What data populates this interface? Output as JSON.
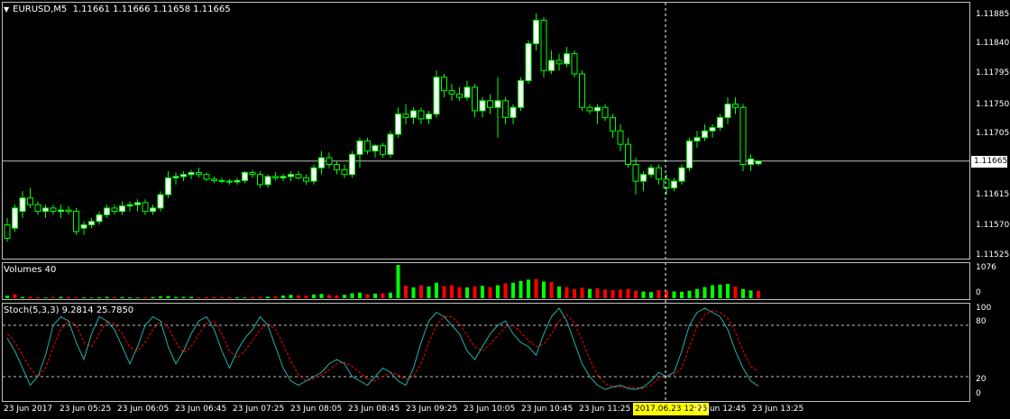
{
  "main": {
    "symbol": "EURUSD,M5",
    "ohlc": "1.11661 1.11666 1.11658 1.11665",
    "price_scale": [
      "1.11885",
      "1.11840",
      "1.11795",
      "1.11750",
      "1.11705",
      "1.11615",
      "1.11570",
      "1.11525"
    ],
    "current_price_label": "1.11665"
  },
  "volumes": {
    "title": "Volumes 40",
    "scale": [
      "1076",
      "0"
    ]
  },
  "stoch": {
    "title": "Stoch(5,3,3) 9.2814 25.7850",
    "scale": [
      "100",
      "80",
      "20",
      "0"
    ]
  },
  "time_axis": {
    "ticks": [
      "23 Jun 2017",
      "23 Jun 05:25",
      "23 Jun 06:05",
      "23 Jun 06:45",
      "23 Jun 07:25",
      "23 Jun 08:05",
      "23 Jun 08:45",
      "23 Jun 09:25",
      "23 Jun 10:05",
      "23 Jun 10:45",
      "23 Jun 11:25",
      "23 Jun 12:45",
      "23 Jun 13:25"
    ],
    "crosshair_time": "2017.06.23 12:25"
  },
  "colors": {
    "background": "#000000",
    "candle_up": "#ffffff",
    "candle_wick": "#00ff00",
    "volume_up": "#00ff00",
    "volume_down": "#ff0000",
    "stoch_main": "#20b2aa",
    "stoch_signal": "#ff0000",
    "grid_frame": "#c0c0c0"
  },
  "chart_data": {
    "type": "candlestick",
    "symbol": "EURUSD",
    "timeframe": "M5",
    "ylim": [
      1.115,
      1.119
    ],
    "candles": [
      [
        1.1157,
        1.1158,
        1.11545,
        1.1155
      ],
      [
        1.11565,
        1.116,
        1.1156,
        1.11595
      ],
      [
        1.1159,
        1.1162,
        1.1158,
        1.1161
      ],
      [
        1.1161,
        1.11625,
        1.11595,
        1.116
      ],
      [
        1.116,
        1.11605,
        1.11585,
        1.1159
      ],
      [
        1.1159,
        1.116,
        1.1158,
        1.11595
      ],
      [
        1.11595,
        1.116,
        1.11585,
        1.1159
      ],
      [
        1.1159,
        1.116,
        1.1158,
        1.11592
      ],
      [
        1.11592,
        1.11598,
        1.11585,
        1.1159
      ],
      [
        1.1159,
        1.11595,
        1.11555,
        1.1156
      ],
      [
        1.11565,
        1.11575,
        1.11555,
        1.1157
      ],
      [
        1.1157,
        1.1158,
        1.11565,
        1.11575
      ],
      [
        1.11575,
        1.1159,
        1.1157,
        1.11585
      ],
      [
        1.11585,
        1.116,
        1.1158,
        1.11595
      ],
      [
        1.11595,
        1.116,
        1.11585,
        1.1159
      ],
      [
        1.1159,
        1.11605,
        1.11585,
        1.11598
      ],
      [
        1.11598,
        1.11605,
        1.1159,
        1.116
      ],
      [
        1.116,
        1.11608,
        1.1159,
        1.11603
      ],
      [
        1.11603,
        1.11608,
        1.11585,
        1.1159
      ],
      [
        1.1159,
        1.116,
        1.11585,
        1.11595
      ],
      [
        1.11595,
        1.1162,
        1.1159,
        1.11615
      ],
      [
        1.11615,
        1.1165,
        1.1161,
        1.1164
      ],
      [
        1.1164,
        1.11648,
        1.1163,
        1.11642
      ],
      [
        1.11642,
        1.1165,
        1.11635,
        1.11645
      ],
      [
        1.11645,
        1.11652,
        1.11638,
        1.11648
      ],
      [
        1.11648,
        1.11655,
        1.1164,
        1.11645
      ],
      [
        1.11645,
        1.11648,
        1.11635,
        1.11638
      ],
      [
        1.11638,
        1.11642,
        1.11632,
        1.11636
      ],
      [
        1.11636,
        1.1164,
        1.11632,
        1.11635
      ],
      [
        1.11635,
        1.11638,
        1.1163,
        1.11634
      ],
      [
        1.11634,
        1.1164,
        1.1163,
        1.11636
      ],
      [
        1.11636,
        1.1165,
        1.11632,
        1.11648
      ],
      [
        1.11648,
        1.11652,
        1.1164,
        1.11645
      ],
      [
        1.11645,
        1.1165,
        1.11625,
        1.1163
      ],
      [
        1.1163,
        1.11645,
        1.11625,
        1.11642
      ],
      [
        1.11642,
        1.11648,
        1.11636,
        1.1164
      ],
      [
        1.1164,
        1.11646,
        1.11635,
        1.11642
      ],
      [
        1.11642,
        1.1165,
        1.11635,
        1.11645
      ],
      [
        1.11645,
        1.1165,
        1.11638,
        1.1164
      ],
      [
        1.1164,
        1.11645,
        1.1163,
        1.11635
      ],
      [
        1.11635,
        1.1166,
        1.1163,
        1.11655
      ],
      [
        1.11655,
        1.1168,
        1.11645,
        1.1167
      ],
      [
        1.1167,
        1.11678,
        1.11655,
        1.1166
      ],
      [
        1.1166,
        1.11665,
        1.11645,
        1.11652
      ],
      [
        1.11652,
        1.1166,
        1.1164,
        1.11645
      ],
      [
        1.11645,
        1.1168,
        1.1164,
        1.11675
      ],
      [
        1.11675,
        1.117,
        1.11655,
        1.11695
      ],
      [
        1.11695,
        1.117,
        1.11675,
        1.1168
      ],
      [
        1.1168,
        1.1169,
        1.1167,
        1.11688
      ],
      [
        1.11688,
        1.11692,
        1.1167,
        1.11675
      ],
      [
        1.11675,
        1.1171,
        1.1167,
        1.11705
      ],
      [
        1.11705,
        1.11745,
        1.117,
        1.11735
      ],
      [
        1.11735,
        1.1175,
        1.1172,
        1.1173
      ],
      [
        1.1173,
        1.11745,
        1.1172,
        1.1174
      ],
      [
        1.1174,
        1.11745,
        1.1172,
        1.11728
      ],
      [
        1.11728,
        1.1174,
        1.1172,
        1.11735
      ],
      [
        1.11735,
        1.118,
        1.1173,
        1.1179
      ],
      [
        1.1179,
        1.11795,
        1.1176,
        1.1177
      ],
      [
        1.1177,
        1.1178,
        1.11755,
        1.11765
      ],
      [
        1.11765,
        1.11775,
        1.11755,
        1.1176
      ],
      [
        1.1176,
        1.11785,
        1.11755,
        1.11775
      ],
      [
        1.11775,
        1.1178,
        1.1173,
        1.1174
      ],
      [
        1.1174,
        1.1176,
        1.1173,
        1.11755
      ],
      [
        1.11755,
        1.11765,
        1.11735,
        1.11745
      ],
      [
        1.11745,
        1.1179,
        1.117,
        1.11755
      ],
      [
        1.11755,
        1.1176,
        1.1172,
        1.1173
      ],
      [
        1.1173,
        1.1175,
        1.1172,
        1.11745
      ],
      [
        1.11745,
        1.1179,
        1.1174,
        1.11785
      ],
      [
        1.11785,
        1.11845,
        1.1178,
        1.1184
      ],
      [
        1.1184,
        1.11885,
        1.1183,
        1.11875
      ],
      [
        1.11875,
        1.1188,
        1.1179,
        1.118
      ],
      [
        1.118,
        1.1183,
        1.11795,
        1.11815
      ],
      [
        1.11815,
        1.11825,
        1.118,
        1.1181
      ],
      [
        1.1181,
        1.11835,
        1.11805,
        1.11825
      ],
      [
        1.11825,
        1.1183,
        1.1179,
        1.11795
      ],
      [
        1.11795,
        1.118,
        1.1174,
        1.11745
      ],
      [
        1.11745,
        1.1175,
        1.11735,
        1.1174
      ],
      [
        1.1174,
        1.1175,
        1.1172,
        1.11745
      ],
      [
        1.11745,
        1.1175,
        1.11725,
        1.1173
      ],
      [
        1.1173,
        1.11735,
        1.117,
        1.1171
      ],
      [
        1.1171,
        1.1172,
        1.1168,
        1.1169
      ],
      [
        1.1169,
        1.117,
        1.11655,
        1.1166
      ],
      [
        1.1166,
        1.1167,
        1.11615,
        1.11635
      ],
      [
        1.11635,
        1.1165,
        1.1162,
        1.11645
      ],
      [
        1.11645,
        1.1166,
        1.1164,
        1.11655
      ],
      [
        1.11655,
        1.1166,
        1.1163,
        1.11638
      ],
      [
        1.11638,
        1.11645,
        1.11615,
        1.11625
      ],
      [
        1.11625,
        1.1164,
        1.1162,
        1.11635
      ],
      [
        1.11635,
        1.1166,
        1.1163,
        1.11655
      ],
      [
        1.11655,
        1.117,
        1.1165,
        1.11695
      ],
      [
        1.11695,
        1.1171,
        1.11685,
        1.117
      ],
      [
        1.117,
        1.1172,
        1.11695,
        1.1171
      ],
      [
        1.1171,
        1.1172,
        1.117,
        1.11715
      ],
      [
        1.11715,
        1.11735,
        1.1171,
        1.1173
      ],
      [
        1.1173,
        1.1176,
        1.1172,
        1.1175
      ],
      [
        1.1175,
        1.1176,
        1.11735,
        1.11745
      ],
      [
        1.11745,
        1.1175,
        1.1165,
        1.1166
      ],
      [
        1.1166,
        1.11675,
        1.1165,
        1.11668
      ],
      [
        1.11661,
        1.11666,
        1.11658,
        1.11665
      ]
    ],
    "volume": [
      80,
      130,
      40,
      45,
      35,
      25,
      30,
      45,
      40,
      25,
      30,
      20,
      30,
      45,
      35,
      40,
      30,
      25,
      30,
      40,
      60,
      70,
      35,
      40,
      45,
      30,
      35,
      40,
      30,
      35,
      30,
      25,
      40,
      45,
      50,
      60,
      90,
      110,
      95,
      85,
      120,
      140,
      100,
      90,
      110,
      160,
      180,
      130,
      150,
      160,
      180,
      1076,
      400,
      350,
      420,
      380,
      500,
      390,
      420,
      360,
      350,
      380,
      400,
      360,
      420,
      480,
      500,
      560,
      600,
      620,
      540,
      520,
      380,
      360,
      300,
      340,
      300,
      320,
      280,
      260,
      280,
      300,
      240,
      220,
      200,
      260,
      240,
      220,
      210,
      240,
      300,
      360,
      420,
      440,
      460,
      380,
      300,
      250,
      240
    ],
    "volume_direction": [
      1,
      0,
      1,
      0,
      0,
      1,
      0,
      1,
      0,
      0,
      1,
      1,
      1,
      1,
      0,
      1,
      1,
      1,
      0,
      1,
      1,
      1,
      1,
      1,
      1,
      0,
      0,
      0,
      0,
      0,
      1,
      1,
      0,
      0,
      1,
      0,
      1,
      1,
      0,
      0,
      1,
      1,
      0,
      0,
      1,
      1,
      1,
      0,
      1,
      0,
      1,
      1,
      0,
      1,
      0,
      1,
      1,
      0,
      0,
      0,
      1,
      0,
      1,
      0,
      1,
      0,
      1,
      1,
      1,
      0,
      1,
      0,
      1,
      0,
      0,
      0,
      1,
      0,
      0,
      0,
      0,
      0,
      0,
      1,
      1,
      0,
      0,
      1,
      1,
      1,
      1,
      1,
      1,
      1,
      1,
      0,
      1,
      1,
      0
    ],
    "stoch_main": [
      65,
      50,
      30,
      10,
      20,
      45,
      80,
      90,
      85,
      60,
      40,
      70,
      90,
      85,
      75,
      55,
      35,
      55,
      80,
      90,
      85,
      55,
      35,
      50,
      70,
      85,
      90,
      75,
      50,
      30,
      50,
      65,
      75,
      90,
      80,
      55,
      30,
      15,
      10,
      15,
      20,
      25,
      35,
      40,
      35,
      20,
      15,
      10,
      20,
      30,
      25,
      15,
      10,
      30,
      60,
      85,
      95,
      90,
      80,
      70,
      50,
      40,
      55,
      70,
      80,
      85,
      70,
      60,
      55,
      45,
      70,
      90,
      100,
      85,
      60,
      35,
      20,
      10,
      5,
      8,
      10,
      6,
      5,
      8,
      15,
      25,
      20,
      25,
      50,
      80,
      95,
      100,
      95,
      90,
      75,
      50,
      30,
      15,
      9
    ],
    "stoch_signal": [
      70,
      60,
      45,
      30,
      20,
      30,
      55,
      75,
      85,
      80,
      60,
      55,
      70,
      85,
      82,
      70,
      55,
      50,
      60,
      75,
      85,
      78,
      60,
      48,
      55,
      70,
      82,
      85,
      70,
      50,
      42,
      50,
      62,
      75,
      82,
      75,
      58,
      38,
      22,
      15,
      18,
      22,
      28,
      35,
      37,
      32,
      25,
      17,
      15,
      20,
      25,
      22,
      17,
      20,
      35,
      60,
      80,
      90,
      90,
      82,
      68,
      55,
      50,
      58,
      68,
      78,
      80,
      72,
      62,
      55,
      58,
      70,
      85,
      92,
      83,
      62,
      40,
      22,
      12,
      8,
      8,
      8,
      7,
      6,
      10,
      18,
      22,
      22,
      30,
      55,
      78,
      92,
      97,
      95,
      88,
      72,
      50,
      32,
      26
    ]
  }
}
